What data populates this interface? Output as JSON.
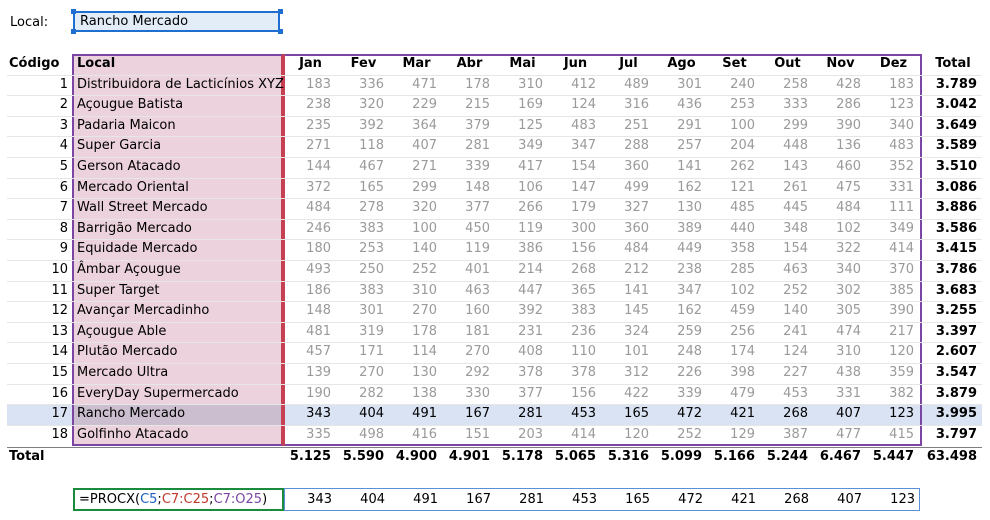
{
  "lookup": {
    "label": "Local:",
    "value": "Rancho Mercado"
  },
  "table": {
    "headers": {
      "code": "Código",
      "local": "Local",
      "months": [
        "Jan",
        "Fev",
        "Mar",
        "Abr",
        "Mai",
        "Jun",
        "Jul",
        "Ago",
        "Set",
        "Out",
        "Nov",
        "Dez"
      ],
      "total": "Total"
    },
    "rows": [
      {
        "code": "1",
        "local": "Distribuidora de Lacticínios XYZ",
        "values": [
          "183",
          "336",
          "471",
          "178",
          "310",
          "412",
          "489",
          "301",
          "240",
          "258",
          "428",
          "183"
        ],
        "total": "3.789"
      },
      {
        "code": "2",
        "local": "Açougue Batista",
        "values": [
          "238",
          "320",
          "229",
          "215",
          "169",
          "124",
          "316",
          "436",
          "253",
          "333",
          "286",
          "123"
        ],
        "total": "3.042"
      },
      {
        "code": "3",
        "local": "Padaria Maicon",
        "values": [
          "235",
          "392",
          "364",
          "379",
          "125",
          "483",
          "251",
          "291",
          "100",
          "299",
          "390",
          "340"
        ],
        "total": "3.649"
      },
      {
        "code": "4",
        "local": "Super Garcia",
        "values": [
          "271",
          "118",
          "407",
          "281",
          "349",
          "347",
          "288",
          "257",
          "204",
          "448",
          "136",
          "483"
        ],
        "total": "3.589"
      },
      {
        "code": "5",
        "local": "Gerson Atacado",
        "values": [
          "144",
          "467",
          "271",
          "339",
          "417",
          "154",
          "360",
          "141",
          "262",
          "143",
          "460",
          "352"
        ],
        "total": "3.510"
      },
      {
        "code": "6",
        "local": "Mercado Oriental",
        "values": [
          "372",
          "165",
          "299",
          "148",
          "106",
          "147",
          "499",
          "162",
          "121",
          "261",
          "475",
          "331"
        ],
        "total": "3.086"
      },
      {
        "code": "7",
        "local": "Wall Street Mercado",
        "values": [
          "484",
          "278",
          "320",
          "377",
          "266",
          "179",
          "327",
          "130",
          "485",
          "445",
          "484",
          "111"
        ],
        "total": "3.886"
      },
      {
        "code": "8",
        "local": "Barrigão Mercado",
        "values": [
          "246",
          "383",
          "100",
          "450",
          "119",
          "300",
          "360",
          "389",
          "440",
          "348",
          "102",
          "349"
        ],
        "total": "3.586"
      },
      {
        "code": "9",
        "local": "Equidade Mercado",
        "values": [
          "180",
          "253",
          "140",
          "119",
          "386",
          "156",
          "484",
          "449",
          "358",
          "154",
          "322",
          "414"
        ],
        "total": "3.415"
      },
      {
        "code": "10",
        "local": "Âmbar Açougue",
        "values": [
          "493",
          "250",
          "252",
          "401",
          "214",
          "268",
          "212",
          "238",
          "285",
          "463",
          "340",
          "370"
        ],
        "total": "3.786"
      },
      {
        "code": "11",
        "local": "Super Target",
        "values": [
          "186",
          "383",
          "310",
          "463",
          "447",
          "365",
          "141",
          "347",
          "102",
          "252",
          "302",
          "385"
        ],
        "total": "3.683"
      },
      {
        "code": "12",
        "local": "Avançar Mercadinho",
        "values": [
          "148",
          "301",
          "270",
          "160",
          "392",
          "383",
          "145",
          "162",
          "459",
          "140",
          "305",
          "390"
        ],
        "total": "3.255"
      },
      {
        "code": "13",
        "local": "Açougue Able",
        "values": [
          "481",
          "319",
          "178",
          "181",
          "231",
          "236",
          "324",
          "259",
          "256",
          "241",
          "474",
          "217"
        ],
        "total": "3.397"
      },
      {
        "code": "14",
        "local": "Plutão Mercado",
        "values": [
          "457",
          "171",
          "114",
          "270",
          "408",
          "110",
          "101",
          "248",
          "174",
          "124",
          "310",
          "120"
        ],
        "total": "2.607"
      },
      {
        "code": "15",
        "local": "Mercado Ultra",
        "values": [
          "139",
          "270",
          "130",
          "292",
          "378",
          "378",
          "312",
          "226",
          "398",
          "227",
          "438",
          "359"
        ],
        "total": "3.547"
      },
      {
        "code": "16",
        "local": "EveryDay Supermercado",
        "values": [
          "190",
          "282",
          "138",
          "330",
          "377",
          "156",
          "422",
          "339",
          "479",
          "453",
          "331",
          "382"
        ],
        "total": "3.879"
      },
      {
        "code": "17",
        "local": "Rancho Mercado",
        "values": [
          "343",
          "404",
          "491",
          "167",
          "281",
          "453",
          "165",
          "472",
          "421",
          "268",
          "407",
          "123"
        ],
        "total": "3.995"
      },
      {
        "code": "18",
        "local": "Golfinho Atacado",
        "values": [
          "335",
          "498",
          "416",
          "151",
          "203",
          "414",
          "120",
          "252",
          "129",
          "387",
          "477",
          "415"
        ],
        "total": "3.797"
      }
    ],
    "totals": {
      "label": "Total",
      "values": [
        "5.125",
        "5.590",
        "4.900",
        "4.901",
        "5.178",
        "5.065",
        "5.316",
        "5.099",
        "5.166",
        "5.244",
        "6.467",
        "5.447"
      ],
      "grand_total": "63.498"
    }
  },
  "formula": {
    "prefix": "=PROCX(",
    "arg1": "C5",
    "sep1": ";",
    "arg2": "C7:C25",
    "sep2": ";",
    "arg3": "C7:O25",
    "suffix": ")",
    "results": [
      "343",
      "404",
      "491",
      "167",
      "281",
      "453",
      "165",
      "472",
      "421",
      "268",
      "407",
      "123"
    ]
  },
  "colors": {
    "selection": "#1e6fd0",
    "ref1": "#1f5fbf",
    "ref2": "#c0392b",
    "ref3": "#7b46a3",
    "formula_border": "#1a8a3d"
  }
}
